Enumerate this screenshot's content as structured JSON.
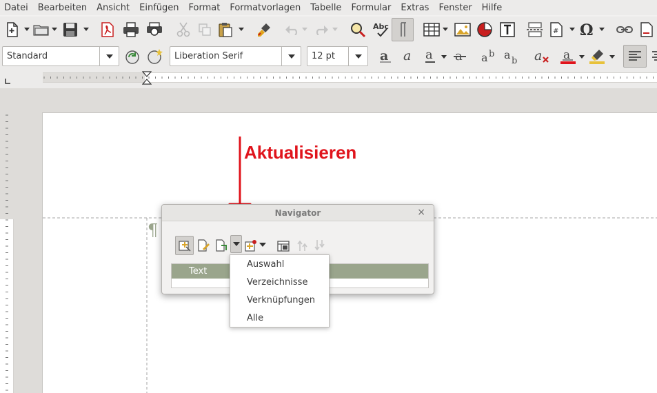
{
  "menubar": {
    "items": [
      "Datei",
      "Bearbeiten",
      "Ansicht",
      "Einfügen",
      "Format",
      "Formatvorlagen",
      "Tabelle",
      "Formular",
      "Extras",
      "Fenster",
      "Hilfe"
    ]
  },
  "formatting_toolbar": {
    "paragraph_style": "Standard",
    "font_name": "Liberation Serif",
    "font_size": "12 pt"
  },
  "annotation": {
    "label": "Aktualisieren",
    "color": "#e0141c"
  },
  "navigator": {
    "title": "Navigator",
    "close_glyph": "×",
    "list_header": "Text"
  },
  "dropdown_menu": {
    "items": [
      "Auswahl",
      "Verzeichnisse",
      "Verknüpfungen",
      "Alle"
    ]
  },
  "document": {
    "pilcrow": "¶"
  },
  "colors": {
    "list_header_bg": "#9aa58c",
    "annotation_red": "#e0141c"
  }
}
